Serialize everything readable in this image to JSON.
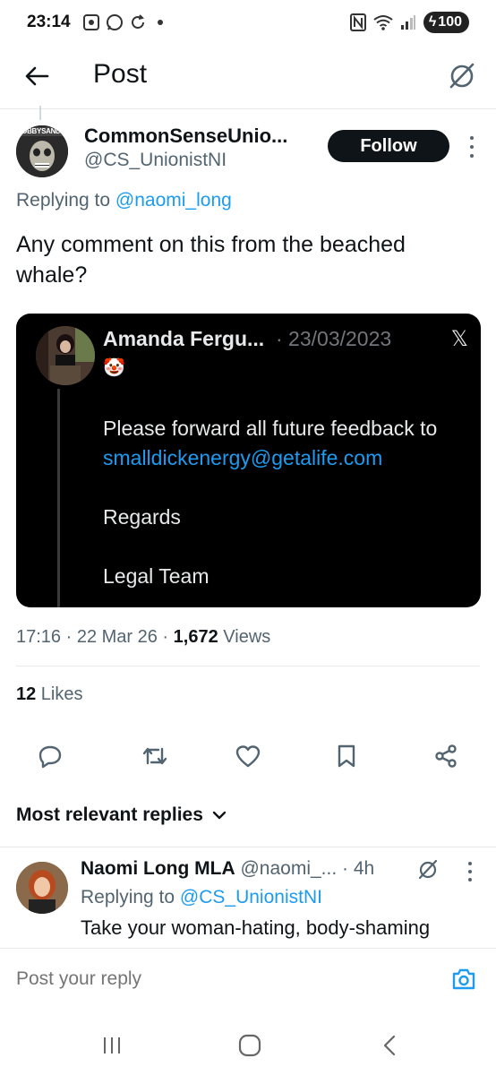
{
  "status_bar": {
    "time": "23:14",
    "battery": "100",
    "icons": [
      "screenshot-icon",
      "whatsapp-icon",
      "sync-icon",
      "nfc-icon",
      "wifi-icon",
      "signal-icon"
    ]
  },
  "header": {
    "title": "Post",
    "back_icon": "arrow-left-icon",
    "grok_icon": "grok-icon"
  },
  "tweet": {
    "author_name": "CommonSenseUnio...",
    "author_handle": "@CS_UnionistNI",
    "avatar_label": "JOBBYSANDS",
    "follow_label": "Follow",
    "replying_prefix": "Replying to",
    "replying_handle": "@naomi_long",
    "text": "Any comment on this from the beached whale?",
    "embed": {
      "name": "Amanda Fergu...",
      "date": "· 23/03/2023",
      "x_logo": "𝕏",
      "emoji": "🤡",
      "line1": "Please forward all future feedback to",
      "email": "smalldickenergy@getalife.com",
      "line3": "Regards",
      "line4": "Legal Team"
    },
    "time": "17:16 · 22 Mar 26 · ",
    "views_count": "1,672",
    "views_label": " Views",
    "likes_count": "12",
    "likes_label": " Likes"
  },
  "actions": [
    "reply-icon",
    "repost-icon",
    "like-icon",
    "bookmark-icon",
    "share-icon"
  ],
  "replies_header": "Most relevant replies",
  "reply": {
    "name": "Naomi Long MLA",
    "handle": " @naomi_... · 4h",
    "replying_prefix": "Replying to",
    "replying_handle": "@CS_UnionistNI",
    "text": "Take your woman-hating, body-shaming"
  },
  "compose": {
    "placeholder": "Post your reply"
  },
  "colors": {
    "accent": "#1d9bf0",
    "text": "#0f1419",
    "secondary": "#536471"
  }
}
